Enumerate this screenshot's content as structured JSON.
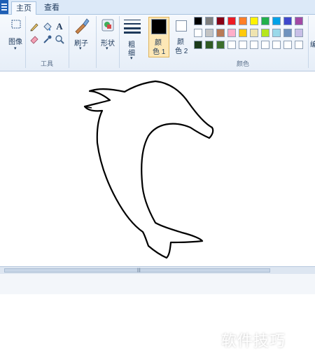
{
  "tabs": {
    "home": "主页",
    "view": "查看"
  },
  "ribbon": {
    "image_label": "图像",
    "tools_group": "工具",
    "brushes_label": "刷子",
    "shapes_label": "形状",
    "size_label_1": "粗",
    "size_label_2": "细",
    "color1_label_1": "颜",
    "color1_label_2": "色 1",
    "color2_label_1": "颜",
    "color2_label_2": "色 2",
    "colors_group": "颜色",
    "edit_colors_partial": "编"
  },
  "icons": {
    "text_tool": "A",
    "select": "select-icon",
    "pencil": "pencil-icon",
    "fill": "fill-icon",
    "eraser": "eraser-icon",
    "color_picker": "color-picker-icon",
    "magnifier": "magnifier-icon"
  },
  "colors": {
    "color1": "#000000",
    "color2": "#ffffff",
    "palette": [
      [
        "#000000",
        "#7f7f7f",
        "#880015",
        "#ed1c24",
        "#ff7f27",
        "#fff200",
        "#22b14c",
        "#00a2e8",
        "#3f48cc",
        "#a349a4"
      ],
      [
        "#ffffff",
        "#c3c3c3",
        "#b97a57",
        "#ffaec9",
        "#ffc90e",
        "#efe4b0",
        "#b5e61d",
        "#99d9ea",
        "#7092be",
        "#c8bfe7"
      ],
      [
        "#1a3a1a",
        "#2f5a24",
        "#3c6e2d",
        "#ffffff",
        "#ffffff",
        "#ffffff",
        "#ffffff",
        "#ffffff",
        "#ffffff",
        "#ffffff"
      ]
    ]
  },
  "watermark": "软件技巧"
}
